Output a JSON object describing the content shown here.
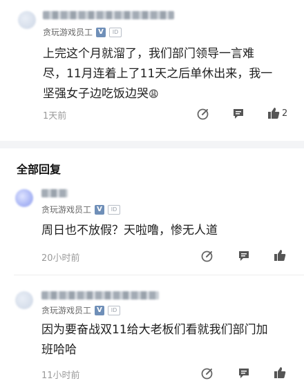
{
  "comments": [
    {
      "user_title": "贪玩游戏员工",
      "text_lines": [
        "上完这个月就溜了，我们部门领导一言难",
        "尽，11月连着上了11天之后单休出来，我一",
        "坚强女子边吃饭边哭"
      ],
      "emoji": "😩",
      "time": "1天前",
      "likes": "2"
    }
  ],
  "section_title": "全部回复",
  "replies": [
    {
      "user_title": "贪玩游戏员工",
      "text_lines": [
        "周日也不放假？天啦噜，惨无人道"
      ],
      "time": "20小时前"
    },
    {
      "user_title": "贪玩游戏员工",
      "text_lines": [
        "因为要奋战双11给大老板们看就我们部门加",
        "班哈哈"
      ],
      "time": "11小时前"
    }
  ],
  "badges": {
    "verified": "V",
    "id": "ID"
  },
  "icons": [
    "edit-icon",
    "comment-icon",
    "like-icon"
  ],
  "colors": {
    "verified_badge": "#6f8fb8",
    "muted_text": "#9a9a9a"
  }
}
